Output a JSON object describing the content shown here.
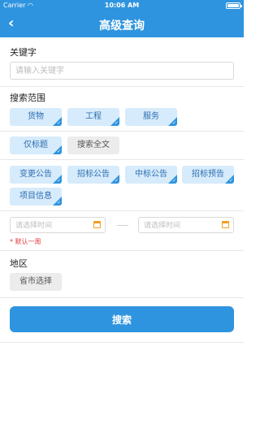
{
  "status_bar": {
    "carrier": "Carrier",
    "time": "10:06 AM"
  },
  "nav": {
    "title": "高级查询",
    "back": "‹"
  },
  "keyword": {
    "label": "关键字",
    "placeholder": "请输入关键字"
  },
  "scope": {
    "label": "搜索范围",
    "categories": [
      {
        "label": "货物",
        "selected": true
      },
      {
        "label": "工程",
        "selected": true
      },
      {
        "label": "服务",
        "selected": true
      }
    ],
    "match_mode": [
      {
        "label": "仅标题",
        "selected": true
      },
      {
        "label": "搜索全文",
        "selected": false
      }
    ],
    "announcement_types": [
      {
        "label": "变更公告",
        "selected": true
      },
      {
        "label": "招标公告",
        "selected": true
      },
      {
        "label": "中标公告",
        "selected": true
      },
      {
        "label": "招标预告",
        "selected": true
      },
      {
        "label": "项目信息",
        "selected": true
      }
    ]
  },
  "date_range": {
    "start_placeholder": "请选择时间",
    "end_placeholder": "请选择时间",
    "hint": "* 默认一周"
  },
  "region": {
    "label": "地区",
    "button": "省市选择"
  },
  "search_button": "搜索",
  "colors": {
    "accent": "#2f94df",
    "chip_selected_bg": "#d6ebfb",
    "chip_unselected_bg": "#ececec",
    "hint": "#e03a3a",
    "calendar": "#f0a020"
  }
}
